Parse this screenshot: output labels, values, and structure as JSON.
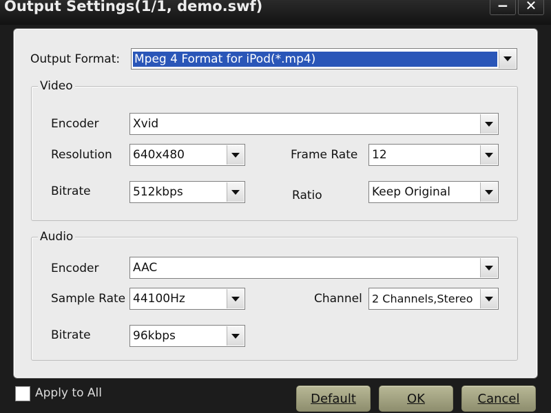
{
  "window": {
    "title": "Output Settings(1/1, demo.swf)",
    "minimize_glyph": "−",
    "close_glyph": "✕"
  },
  "output_format": {
    "label": "Output Format:",
    "value": "Mpeg 4 Format for iPod(*.mp4)"
  },
  "video": {
    "title": "Video",
    "encoder": {
      "label": "Encoder",
      "value": "Xvid"
    },
    "resolution": {
      "label": "Resolution",
      "value": "640x480"
    },
    "frame_rate": {
      "label": "Frame Rate",
      "value": "12"
    },
    "bitrate": {
      "label": "Bitrate",
      "value": "512kbps"
    },
    "ratio": {
      "label": "Ratio",
      "value": "Keep Original"
    }
  },
  "audio": {
    "title": "Audio",
    "encoder": {
      "label": "Encoder",
      "value": "AAC"
    },
    "sample_rate": {
      "label": "Sample Rate",
      "value": "44100Hz"
    },
    "channel": {
      "label": "Channel",
      "value": "2 Channels,Stereo"
    },
    "bitrate": {
      "label": "Bitrate",
      "value": "96kbps"
    }
  },
  "footer": {
    "apply_to_all": "Apply to All",
    "apply_checked": false,
    "default_button": "Default",
    "ok_button": "OK",
    "cancel_button": "Cancel"
  },
  "colors": {
    "selection": "#2a56b8",
    "panel_bg": "#ebebeb",
    "window_bg": "#1c1c1c",
    "button_bg": "#a4a482"
  }
}
